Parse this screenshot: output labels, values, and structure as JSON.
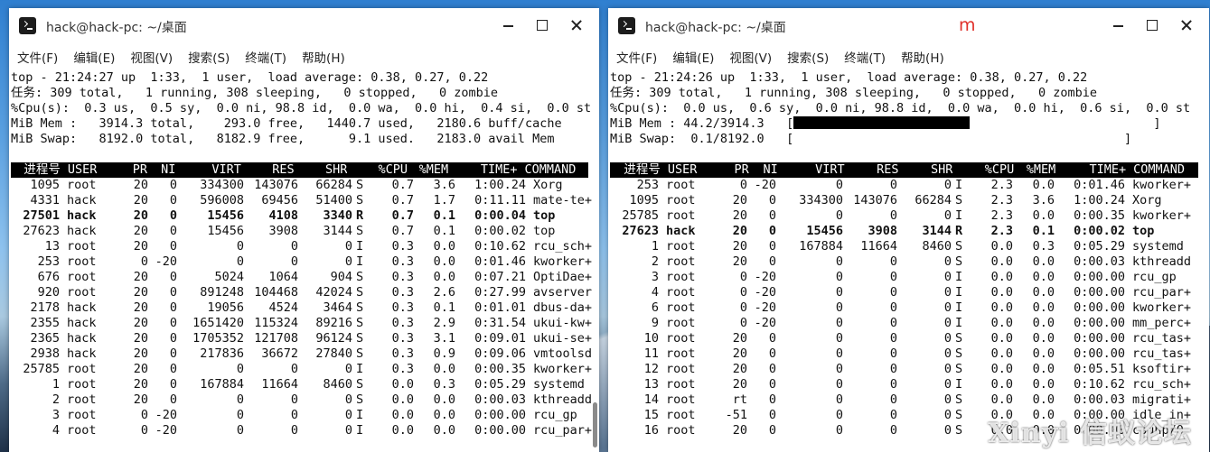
{
  "left": {
    "title": "hack@hack-pc: ~/桌面",
    "menu": [
      "文件(F)",
      "编辑(E)",
      "视图(V)",
      "搜索(S)",
      "终端(T)",
      "帮助(H)"
    ],
    "summary": [
      "top - 21:24:27 up  1:33,  1 user,  load average: 0.38, 0.27, 0.22",
      "任务: 309 total,   1 running, 308 sleeping,   0 stopped,   0 zombie",
      "%Cpu(s):  0.3 us,  0.5 sy,  0.0 ni, 98.8 id,  0.0 wa,  0.0 hi,  0.4 si,  0.0 st",
      "MiB Mem :   3914.3 total,    293.0 free,   1440.7 used,   2180.6 buff/cache",
      "MiB Swap:   8192.0 total,   8182.9 free,      9.1 used.   2183.0 avail Mem"
    ],
    "header": [
      "进程号",
      "USER",
      "PR",
      "NI",
      "VIRT",
      "RES",
      "SHR",
      "",
      "%CPU",
      "%MEM",
      "TIME+",
      "COMMAND"
    ],
    "rows": [
      {
        "c": [
          "1095",
          "root",
          "20",
          "0",
          "334300",
          "143076",
          "66284",
          "S",
          "0.7",
          "3.6",
          "1:00.24",
          "Xorg"
        ]
      },
      {
        "c": [
          "4331",
          "hack",
          "20",
          "0",
          "596008",
          "69456",
          "51400",
          "S",
          "0.7",
          "1.7",
          "0:11.11",
          "mate-te+"
        ]
      },
      {
        "c": [
          "27501",
          "hack",
          "20",
          "0",
          "15456",
          "4108",
          "3340",
          "R",
          "0.7",
          "0.1",
          "0:00.04",
          "top"
        ],
        "bold": true
      },
      {
        "c": [
          "27623",
          "hack",
          "20",
          "0",
          "15456",
          "3908",
          "3144",
          "S",
          "0.7",
          "0.1",
          "0:00.02",
          "top"
        ]
      },
      {
        "c": [
          "13",
          "root",
          "20",
          "0",
          "0",
          "0",
          "0",
          "I",
          "0.3",
          "0.0",
          "0:10.62",
          "rcu_sch+"
        ]
      },
      {
        "c": [
          "253",
          "root",
          "0",
          "-20",
          "0",
          "0",
          "0",
          "I",
          "0.3",
          "0.0",
          "0:01.46",
          "kworker+"
        ]
      },
      {
        "c": [
          "676",
          "root",
          "20",
          "0",
          "5024",
          "1064",
          "904",
          "S",
          "0.3",
          "0.0",
          "0:07.21",
          "OptiDae+"
        ]
      },
      {
        "c": [
          "920",
          "root",
          "20",
          "0",
          "891248",
          "104468",
          "42024",
          "S",
          "0.3",
          "2.6",
          "0:27.99",
          "avserver"
        ]
      },
      {
        "c": [
          "2178",
          "hack",
          "20",
          "0",
          "19056",
          "4524",
          "3464",
          "S",
          "0.3",
          "0.1",
          "0:01.01",
          "dbus-da+"
        ]
      },
      {
        "c": [
          "2355",
          "hack",
          "20",
          "0",
          "1651420",
          "115324",
          "89216",
          "S",
          "0.3",
          "2.9",
          "0:31.54",
          "ukui-kw+"
        ]
      },
      {
        "c": [
          "2365",
          "hack",
          "20",
          "0",
          "1705352",
          "121708",
          "96124",
          "S",
          "0.3",
          "3.1",
          "0:09.01",
          "ukui-se+"
        ]
      },
      {
        "c": [
          "2938",
          "hack",
          "20",
          "0",
          "217836",
          "36672",
          "27840",
          "S",
          "0.3",
          "0.9",
          "0:09.06",
          "vmtoolsd"
        ]
      },
      {
        "c": [
          "25785",
          "root",
          "20",
          "0",
          "0",
          "0",
          "0",
          "I",
          "0.3",
          "0.0",
          "0:00.35",
          "kworker+"
        ]
      },
      {
        "c": [
          "1",
          "root",
          "20",
          "0",
          "167884",
          "11664",
          "8460",
          "S",
          "0.0",
          "0.3",
          "0:05.29",
          "systemd"
        ]
      },
      {
        "c": [
          "2",
          "root",
          "20",
          "0",
          "0",
          "0",
          "0",
          "S",
          "0.0",
          "0.0",
          "0:00.03",
          "kthreadd"
        ]
      },
      {
        "c": [
          "3",
          "root",
          "0",
          "-20",
          "0",
          "0",
          "0",
          "I",
          "0.0",
          "0.0",
          "0:00.00",
          "rcu_gp"
        ]
      },
      {
        "c": [
          "4",
          "root",
          "0",
          "-20",
          "0",
          "0",
          "0",
          "I",
          "0.0",
          "0.0",
          "0:00.00",
          "rcu_par+"
        ]
      }
    ]
  },
  "right": {
    "title": "hack@hack-pc: ~/桌面",
    "mark": "m",
    "menu": [
      "文件(F)",
      "编辑(E)",
      "视图(V)",
      "搜索(S)",
      "终端(T)",
      "帮助(H)"
    ],
    "summary": [
      "top - 21:24:26 up  1:33,  1 user,  load average: 0.38, 0.27, 0.22",
      "任务: 309 total,   1 running, 308 sleeping,   0 stopped,   0 zombie",
      "%Cpu(s):  0.0 us,  0.6 sy,  0.0 ni, 98.8 id,  0.0 wa,  0.0 hi,  0.6 si,  0.0 st"
    ],
    "mem_line_prefix": "MiB Mem : 44.2/3914.3   [",
    "mem_line_suffix": "                         ]",
    "swap_line": "MiB Swap:  0.1/8192.0   [                                             ]",
    "header": [
      "进程号",
      "USER",
      "PR",
      "NI",
      "VIRT",
      "RES",
      "SHR",
      "",
      "%CPU",
      "%MEM",
      "TIME+",
      "COMMAND"
    ],
    "rows": [
      {
        "c": [
          "253",
          "root",
          "0",
          "-20",
          "0",
          "0",
          "0",
          "I",
          "2.3",
          "0.0",
          "0:01.46",
          "kworker+"
        ]
      },
      {
        "c": [
          "1095",
          "root",
          "20",
          "0",
          "334300",
          "143076",
          "66284",
          "S",
          "2.3",
          "3.6",
          "1:00.24",
          "Xorg"
        ]
      },
      {
        "c": [
          "25785",
          "root",
          "20",
          "0",
          "0",
          "0",
          "0",
          "I",
          "2.3",
          "0.0",
          "0:00.35",
          "kworker+"
        ]
      },
      {
        "c": [
          "27623",
          "hack",
          "20",
          "0",
          "15456",
          "3908",
          "3144",
          "R",
          "2.3",
          "0.1",
          "0:00.02",
          "top"
        ],
        "bold": true
      },
      {
        "c": [
          "1",
          "root",
          "20",
          "0",
          "167884",
          "11664",
          "8460",
          "S",
          "0.0",
          "0.3",
          "0:05.29",
          "systemd"
        ]
      },
      {
        "c": [
          "2",
          "root",
          "20",
          "0",
          "0",
          "0",
          "0",
          "S",
          "0.0",
          "0.0",
          "0:00.03",
          "kthreadd"
        ]
      },
      {
        "c": [
          "3",
          "root",
          "0",
          "-20",
          "0",
          "0",
          "0",
          "I",
          "0.0",
          "0.0",
          "0:00.00",
          "rcu_gp"
        ]
      },
      {
        "c": [
          "4",
          "root",
          "0",
          "-20",
          "0",
          "0",
          "0",
          "I",
          "0.0",
          "0.0",
          "0:00.00",
          "rcu_par+"
        ]
      },
      {
        "c": [
          "6",
          "root",
          "0",
          "-20",
          "0",
          "0",
          "0",
          "I",
          "0.0",
          "0.0",
          "0:00.00",
          "kworker+"
        ]
      },
      {
        "c": [
          "9",
          "root",
          "0",
          "-20",
          "0",
          "0",
          "0",
          "I",
          "0.0",
          "0.0",
          "0:00.00",
          "mm_perc+"
        ]
      },
      {
        "c": [
          "10",
          "root",
          "20",
          "0",
          "0",
          "0",
          "0",
          "S",
          "0.0",
          "0.0",
          "0:00.00",
          "rcu_tas+"
        ]
      },
      {
        "c": [
          "11",
          "root",
          "20",
          "0",
          "0",
          "0",
          "0",
          "S",
          "0.0",
          "0.0",
          "0:00.00",
          "rcu_tas+"
        ]
      },
      {
        "c": [
          "12",
          "root",
          "20",
          "0",
          "0",
          "0",
          "0",
          "S",
          "0.0",
          "0.0",
          "0:05.51",
          "ksoftir+"
        ]
      },
      {
        "c": [
          "13",
          "root",
          "20",
          "0",
          "0",
          "0",
          "0",
          "I",
          "0.0",
          "0.0",
          "0:10.62",
          "rcu_sch+"
        ]
      },
      {
        "c": [
          "14",
          "root",
          "rt",
          "0",
          "0",
          "0",
          "0",
          "S",
          "0.0",
          "0.0",
          "0:00.03",
          "migrati+"
        ]
      },
      {
        "c": [
          "15",
          "root",
          "-51",
          "0",
          "0",
          "0",
          "0",
          "S",
          "0.0",
          "0.0",
          "0:00.00",
          "idle_in+"
        ]
      },
      {
        "c": [
          "16",
          "root",
          "20",
          "0",
          "0",
          "0",
          "0",
          "S",
          "0.0",
          "0.0",
          "0:00.00",
          "cpuhp/0"
        ]
      }
    ]
  },
  "watermark": "Xinyi 信蚁论坛"
}
